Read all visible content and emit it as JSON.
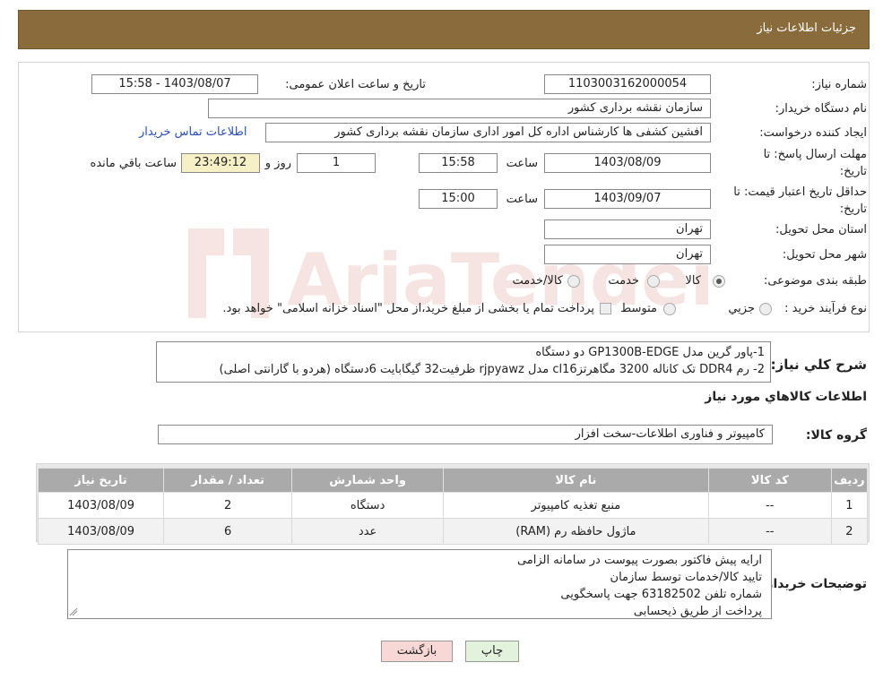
{
  "header": {
    "title": "جزئیات اطلاعات نیاز"
  },
  "form": {
    "need_number_label": "شماره نیاز:",
    "need_number": "1103003162000054",
    "announce_label": "تاریخ و ساعت اعلان عمومی:",
    "announce_value": "1403/08/07 - 15:58",
    "buyer_org_label": "نام دستگاه خریدار:",
    "buyer_org": "سازمان نقشه برداری کشور",
    "requester_label": "ایجاد کننده درخواست:",
    "requester": "افشین کشفی ها کارشناس اداره کل امور اداری سازمان نقشه برداری کشور",
    "contact_link": "اطلاعات تماس خریدار",
    "deadline_label_1": "مهلت ارسال پاسخ: تا",
    "deadline_label_2": "تاریخ:",
    "deadline_date": "1403/08/09",
    "time_label": "ساعت",
    "deadline_time": "15:58",
    "days_value": "1",
    "days_label": "روز و",
    "remaining_time": "23:49:12",
    "remaining_label": "ساعت باقي مانده",
    "validity_label_1": "حداقل تاریخ اعتبار قیمت: تا",
    "validity_label_2": "تاریخ:",
    "validity_date": "1403/09/07",
    "validity_time": "15:00",
    "province_label": "استان محل تحویل:",
    "province": "تهران",
    "city_label": "شهر محل تحویل:",
    "city": "تهران",
    "category_label": "طبقه بندی موضوعی:",
    "category_options": [
      "کالا",
      "خدمت",
      "کالا/خدمت"
    ],
    "process_label": "نوع فرآیند خرید :",
    "process_options": [
      "جزيي",
      "متوسط"
    ],
    "process_note": "پرداخت تمام یا بخشی از مبلغ خرید،از محل \"اسناد خزانه اسلامی\" خواهد بود."
  },
  "watermark": {
    "text": "AriaTender.neT"
  },
  "summary": {
    "label": "شرح کلي نياز:",
    "lines": [
      "1-پاور گرین مدل GP1300B-EDGE    دو دستگاه",
      "2- رم DDR4 تک کاناله 3200 مگاهرتزcl16 مدل rjpyawz ظرفیت32 گیگابایت  6دستگاه   (هردو با گارانتی اصلی)"
    ]
  },
  "goods_info": {
    "title": "اطلاعات کالاهاي مورد نياز"
  },
  "goods_group": {
    "label": "گروه کالا:",
    "value": "کامپیوتر و فناوری اطلاعات-سخت افزار"
  },
  "table": {
    "headers": [
      "رديف",
      "کد کالا",
      "نام کالا",
      "واحد شمارش",
      "تعداد / مقدار",
      "تاریخ نیاز"
    ],
    "rows": [
      [
        "1",
        "--",
        "منبع تغذیه کامپیوتر",
        "دستگاه",
        "2",
        "1403/08/09"
      ],
      [
        "2",
        "--",
        "ماژول حافظه رم (RAM)",
        "عدد",
        "6",
        "1403/08/09"
      ]
    ]
  },
  "notes": {
    "label": "توضیحات خریدار:",
    "lines": [
      "ارایه پیش فاکتور بصورت پیوست در سامانه الزامی",
      "تایید کالا/خدمات  توسط سازمان",
      "شماره تلفن 63182502 جهت پاسخگویی",
      "پرداخت از طریق ذیحسابی"
    ]
  },
  "buttons": {
    "print": "چاپ",
    "back": "بازگشت"
  },
  "colors": {
    "header": "#8a6b3c",
    "back_button": "#f8d7d7",
    "print_button": "#e2f2dc",
    "link": "#2a4fb8"
  }
}
